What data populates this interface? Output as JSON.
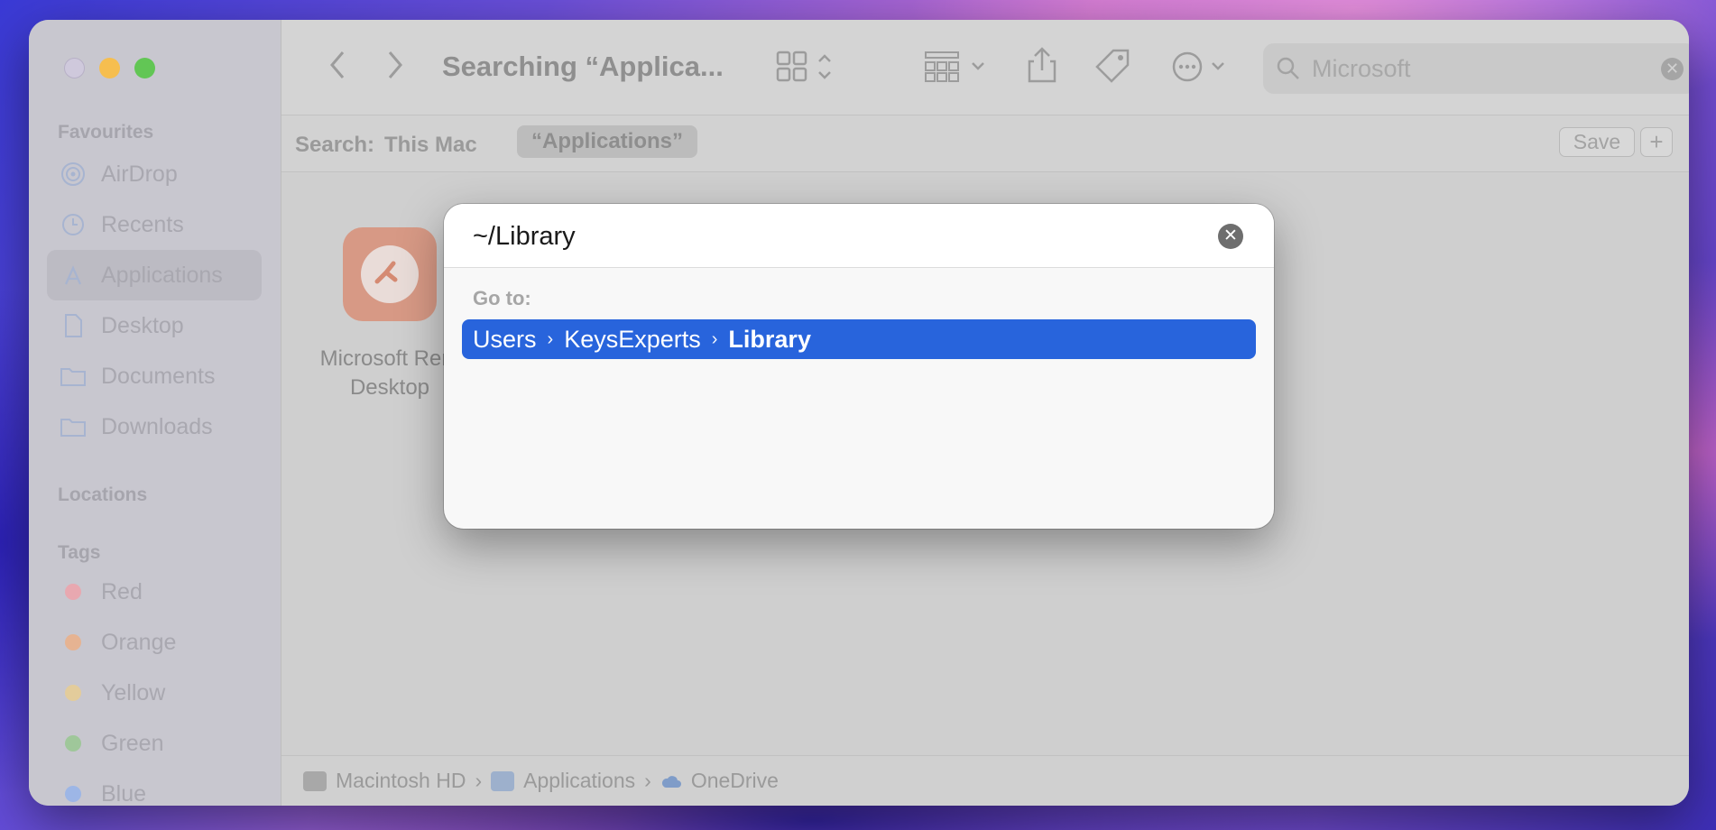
{
  "window": {
    "title": "Searching “Applica...",
    "sidebar": {
      "favourites_heading": "Favourites",
      "favourites": [
        {
          "label": "AirDrop",
          "icon": "airdrop-icon"
        },
        {
          "label": "Recents",
          "icon": "clock-icon"
        },
        {
          "label": "Applications",
          "icon": "applications-icon"
        },
        {
          "label": "Desktop",
          "icon": "document-icon"
        },
        {
          "label": "Documents",
          "icon": "folder-icon"
        },
        {
          "label": "Downloads",
          "icon": "folder-icon"
        }
      ],
      "locations_heading": "Locations",
      "tags_heading": "Tags",
      "tags": [
        {
          "label": "Red",
          "color": "#e8a8b0"
        },
        {
          "label": "Orange",
          "color": "#e6b392"
        },
        {
          "label": "Yellow",
          "color": "#e3cc9b"
        },
        {
          "label": "Green",
          "color": "#9fc79a"
        },
        {
          "label": "Blue",
          "color": "#9db6e6"
        }
      ]
    },
    "toolbar": {
      "search_value": "Microsoft"
    },
    "scope": {
      "label": "Search:",
      "this_mac": "This Mac",
      "applications": "“Applications”",
      "save": "Save",
      "add": "+"
    },
    "content": {
      "items": [
        {
          "label_line1": "Microsoft Rem",
          "label_line2": "Desktop"
        }
      ]
    },
    "pathbar": {
      "segments": [
        "Macintosh HD",
        "Applications",
        "OneDrive"
      ]
    }
  },
  "goto_dialog": {
    "input_value": "~/Library",
    "goto_label": "Go to:",
    "result": {
      "crumbs": [
        "Users",
        "KeysExperts",
        "Library"
      ]
    },
    "accent_color": "#2864dc"
  }
}
